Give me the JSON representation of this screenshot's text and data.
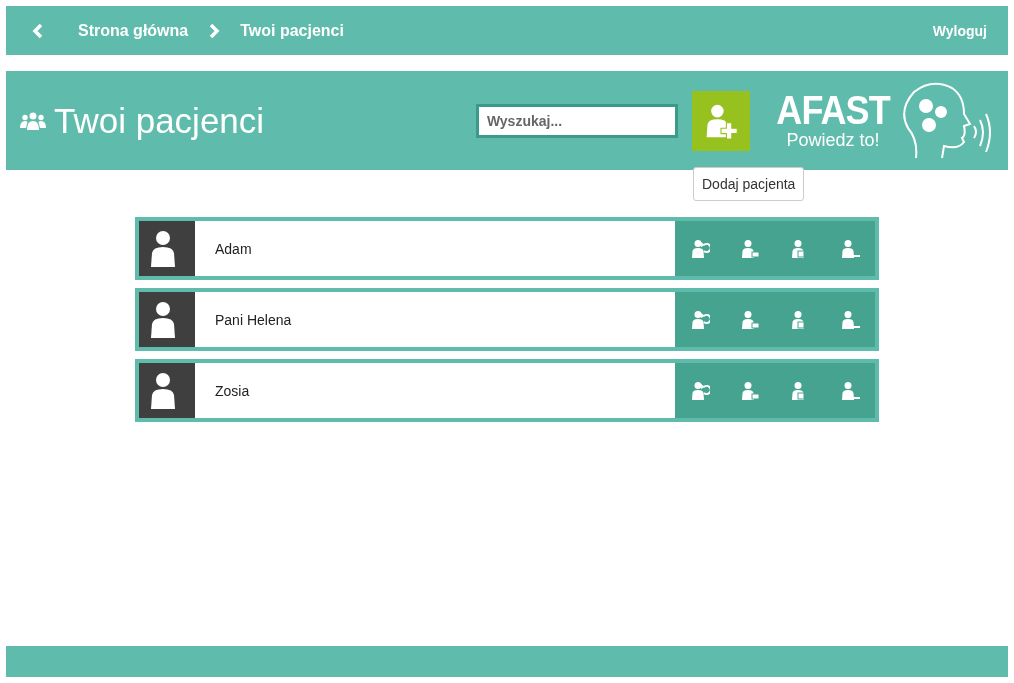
{
  "nav": {
    "back": "Strona główna",
    "current": "Twoi pacjenci",
    "logout": "Wyloguj"
  },
  "header": {
    "title": "Twoi pacjenci",
    "search": {
      "placeholder": "Wyszukaj..."
    },
    "add_tooltip": "Dodaj pacjenta",
    "logo": {
      "name": "AFAST",
      "slogan": "Powiedz to!"
    }
  },
  "patients": [
    {
      "name": "Adam"
    },
    {
      "name": "Pani Helena"
    },
    {
      "name": "Zosia"
    }
  ]
}
